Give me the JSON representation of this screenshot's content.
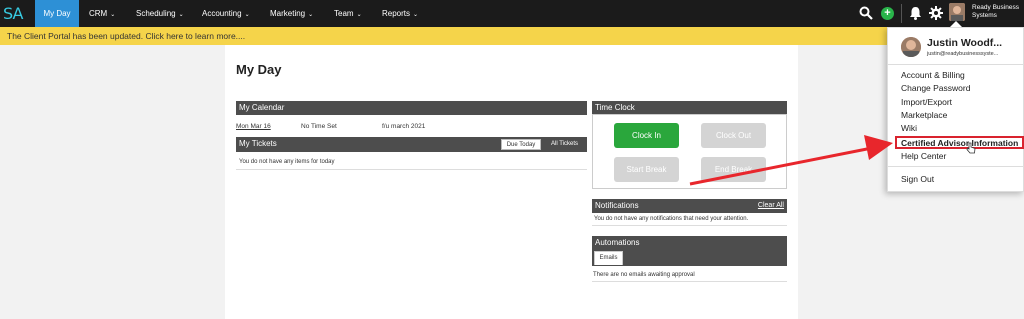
{
  "nav": {
    "logo": "SA",
    "items": [
      {
        "label": "My Day",
        "caret": ""
      },
      {
        "label": "CRM",
        "caret": "⌄"
      },
      {
        "label": "Scheduling",
        "caret": "⌄"
      },
      {
        "label": "Accounting",
        "caret": "⌄"
      },
      {
        "label": "Marketing",
        "caret": "⌄"
      },
      {
        "label": "Team",
        "caret": "⌄"
      },
      {
        "label": "Reports",
        "caret": "⌄"
      }
    ],
    "add_icon": "+",
    "business_name": "Ready Business Systems"
  },
  "banner": {
    "text": "The Client Portal has been updated. Click here to learn more...."
  },
  "page": {
    "title": "My Day"
  },
  "calendar": {
    "header": "My Calendar",
    "date": "Mon Mar 16",
    "time": "No Time Set",
    "note": "f/u march 2021"
  },
  "tickets": {
    "header": "My Tickets",
    "tab_due": "Due Today",
    "tab_all": "All Tickets",
    "empty": "You do not have any items for today"
  },
  "timeclock": {
    "header": "Time Clock",
    "clock_in": "Clock In",
    "clock_out": "Clock Out",
    "start_break": "Start Break",
    "end_break": "End Break"
  },
  "notifications": {
    "header": "Notifications",
    "clear": "Clear All",
    "empty": "You do not have any notifications that need your attention."
  },
  "automations": {
    "header": "Automations",
    "tab": "Emails",
    "empty": "There are no emails awaiting approval"
  },
  "user_menu": {
    "name": "Justin Woodf...",
    "email": "justin@readybusinesssyste...",
    "items": [
      "Account & Billing",
      "Change Password",
      "Import/Export",
      "Marketplace",
      "Wiki",
      "Certified Advisor Information",
      "Help Center",
      "Sign Out"
    ]
  },
  "colors": {
    "nav_bg": "#1b1b1b",
    "active_tab": "#2d90d6",
    "banner": "#f5d44a",
    "panel_header": "#4d4d4d",
    "clock_in": "#2aa73c",
    "disabled_button": "#d4d4d4",
    "highlight_red": "#d9232e"
  },
  "icons": [
    "search-icon",
    "add-icon",
    "bell-icon",
    "gear-icon",
    "avatar",
    "arrow-annotation"
  ]
}
